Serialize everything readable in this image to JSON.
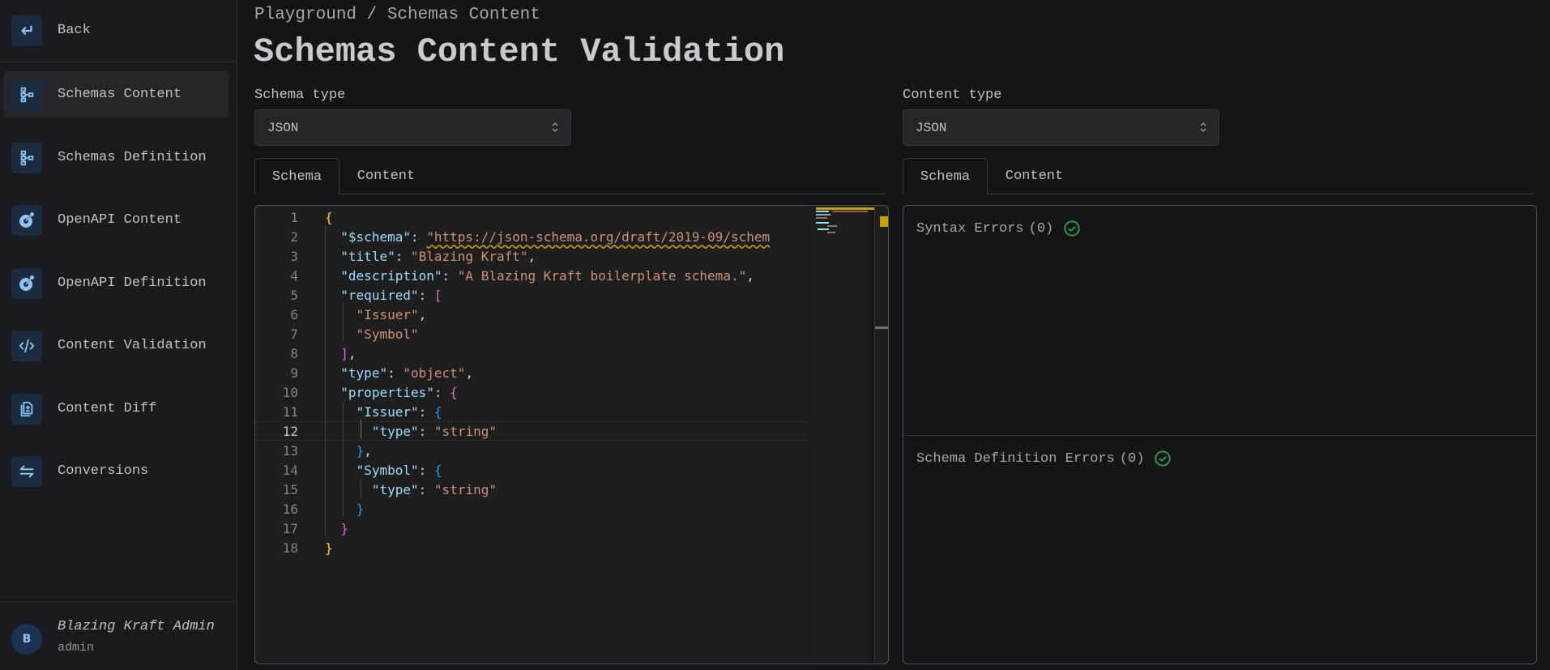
{
  "sidebar": {
    "back": {
      "label": "Back",
      "icon": "arrow-back-icon"
    },
    "items": [
      {
        "label": "Schemas Content",
        "icon": "schema-icon",
        "active": true
      },
      {
        "label": "Schemas Definition",
        "icon": "schema-icon",
        "active": false
      },
      {
        "label": "OpenAPI Content",
        "icon": "openapi-icon",
        "active": false
      },
      {
        "label": "OpenAPI Definition",
        "icon": "openapi-icon",
        "active": false
      },
      {
        "label": "Content Validation",
        "icon": "code-icon",
        "active": false
      },
      {
        "label": "Content Diff",
        "icon": "file-diff-icon",
        "active": false
      },
      {
        "label": "Conversions",
        "icon": "arrows-exchange-icon",
        "active": false
      }
    ],
    "user": {
      "initial": "B",
      "name": "Blazing Kraft Admin",
      "role": "admin"
    }
  },
  "header": {
    "breadcrumb": "Playground / Schemas Content",
    "title": "Schemas Content Validation"
  },
  "left_panel": {
    "select_label": "Schema type",
    "select_value": "JSON",
    "tabs": [
      {
        "label": "Schema",
        "active": true
      },
      {
        "label": "Content",
        "active": false
      }
    ],
    "editor": {
      "current_line": 12,
      "lines": [
        "{",
        "  \"$schema\": \"https://json-schema.org/draft/2019-09/schem",
        "  \"title\": \"Blazing Kraft\",",
        "  \"description\": \"A Blazing Kraft boilerplate schema.\",",
        "  \"required\": [",
        "    \"Issuer\",",
        "    \"Symbol\"",
        "  ],",
        "  \"type\": \"object\",",
        "  \"properties\": {",
        "    \"Issuer\": {",
        "      \"type\": \"string\"",
        "    },",
        "    \"Symbol\": {",
        "      \"type\": \"string\"",
        "    }",
        "  }",
        "}"
      ]
    }
  },
  "right_panel": {
    "select_label": "Content type",
    "select_value": "JSON",
    "tabs": [
      {
        "label": "Schema",
        "active": true
      },
      {
        "label": "Content",
        "active": false
      }
    ],
    "results": [
      {
        "title": "Syntax Errors",
        "count": "(0)",
        "status": "ok"
      },
      {
        "title": "Schema Definition Errors",
        "count": "(0)",
        "status": "ok"
      }
    ]
  },
  "colors": {
    "accent": "#8dc4f0",
    "ok_green": "#2f9e44",
    "warning_yellow": "#c9a400"
  }
}
